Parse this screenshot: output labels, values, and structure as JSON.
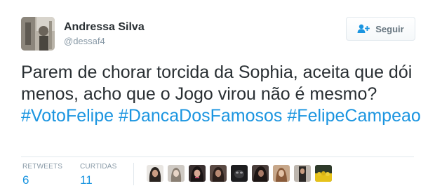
{
  "author": {
    "name": "Andressa Silva",
    "handle": "@dessaf4",
    "avatar_icon": "user-avatar-photo"
  },
  "follow_button": {
    "label": "Seguir",
    "icon": "add-user-icon"
  },
  "tweet": {
    "text_parts": [
      "Parem de chorar torcida da Sophia, aceita que dói menos, acho que o Jogo virou não é mesmo? ",
      "#VotoFelipe",
      " ",
      "#DancaDosFamosos",
      " ",
      "#FelipeCampeao"
    ]
  },
  "stats": {
    "retweets_label": "RETWEETS",
    "retweets_value": "6",
    "likes_label": "CURTIDAS",
    "likes_value": "11"
  },
  "likers": [
    {
      "icon": "liker-avatar-1"
    },
    {
      "icon": "liker-avatar-2"
    },
    {
      "icon": "liker-avatar-3"
    },
    {
      "icon": "liker-avatar-4"
    },
    {
      "icon": "liker-avatar-5"
    },
    {
      "icon": "liker-avatar-6"
    },
    {
      "icon": "liker-avatar-7"
    },
    {
      "icon": "liker-avatar-8"
    },
    {
      "icon": "liker-avatar-9"
    }
  ],
  "colors": {
    "text": "#292f33",
    "link": "#1b95e0",
    "muted": "#8899a6",
    "border": "#e1e8ed"
  }
}
